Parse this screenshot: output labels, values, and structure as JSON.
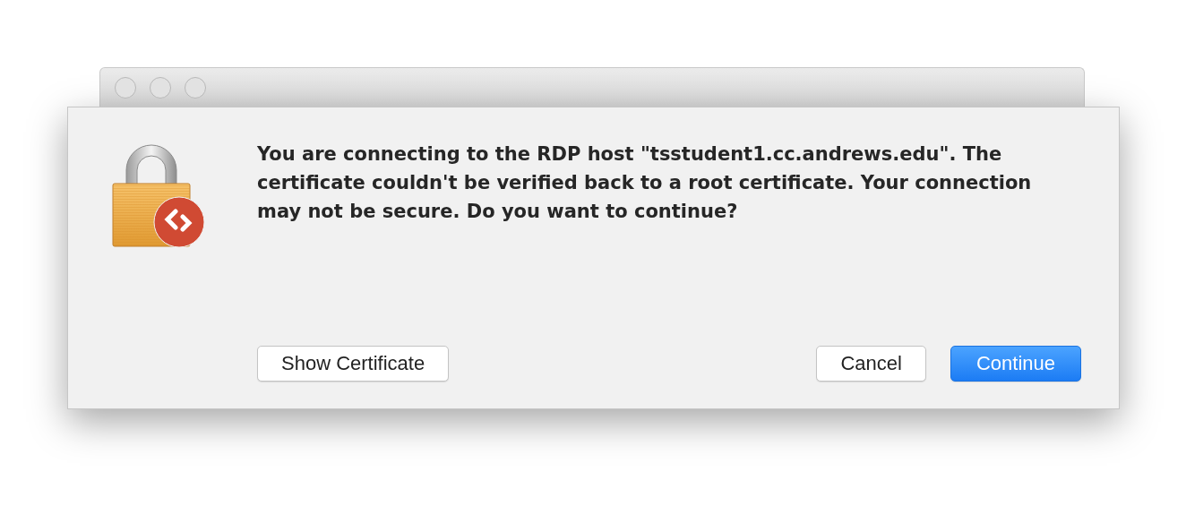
{
  "message": "You are connecting to the RDP host \"tsstudent1.cc.andrews.edu\". The certificate couldn't be verified back to a root certificate. Your connection may not be secure. Do you want to continue?",
  "left_buttons": [
    {
      "label": "Show Certificate",
      "default": false
    }
  ],
  "right_buttons": [
    {
      "label": "Cancel",
      "default": false
    },
    {
      "label": "Continue",
      "default": true
    }
  ]
}
